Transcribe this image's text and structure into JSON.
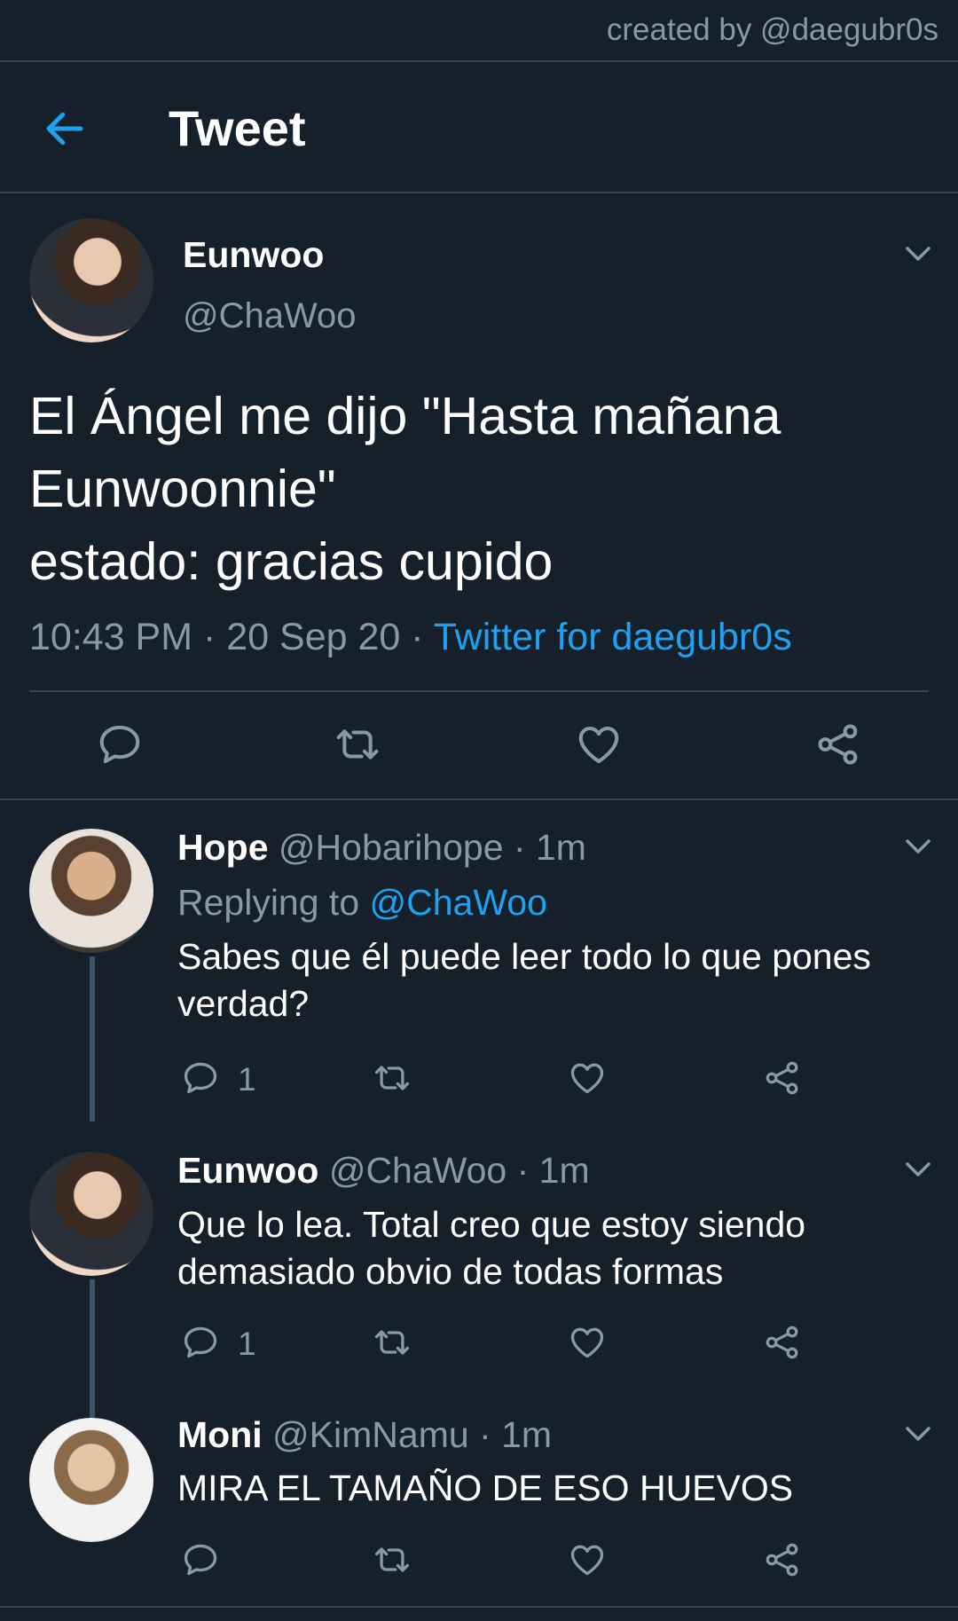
{
  "credit": "created by @daegubr0s",
  "header": {
    "title": "Tweet"
  },
  "main_tweet": {
    "name": "Eunwoo",
    "handle": "@ChaWoo",
    "text": "El Ángel me dijo \"Hasta mañana Eunwoonnie\"\nestado: gracias cupido",
    "time": "10:43 PM",
    "date": "20 Sep 20",
    "source": "Twitter for daegubr0s"
  },
  "replies": [
    {
      "name": "Hope",
      "handle": "@Hobarihope",
      "time": "1m",
      "replying_prefix": "Replying to",
      "replying_to": "@ChaWoo",
      "text": "Sabes que él puede leer todo lo que pones verdad?",
      "reply_count": "1"
    },
    {
      "name": "Eunwoo",
      "handle": "@ChaWoo",
      "time": "1m",
      "text": "Que lo lea. Total creo que estoy siendo demasiado obvio de todas formas",
      "reply_count": "1"
    },
    {
      "name": "Moni",
      "handle": "@KimNamu",
      "time": "1m",
      "text": "MIRA EL TAMAÑO DE ESO HUEVOS"
    }
  ],
  "colors": {
    "background": "#15202b",
    "accent": "#1da1f2",
    "secondary_text": "#8899a6",
    "divider": "#38444d"
  },
  "icons": [
    "back-arrow-icon",
    "chevron-down-icon",
    "reply-icon",
    "retweet-icon",
    "like-icon",
    "share-icon"
  ]
}
